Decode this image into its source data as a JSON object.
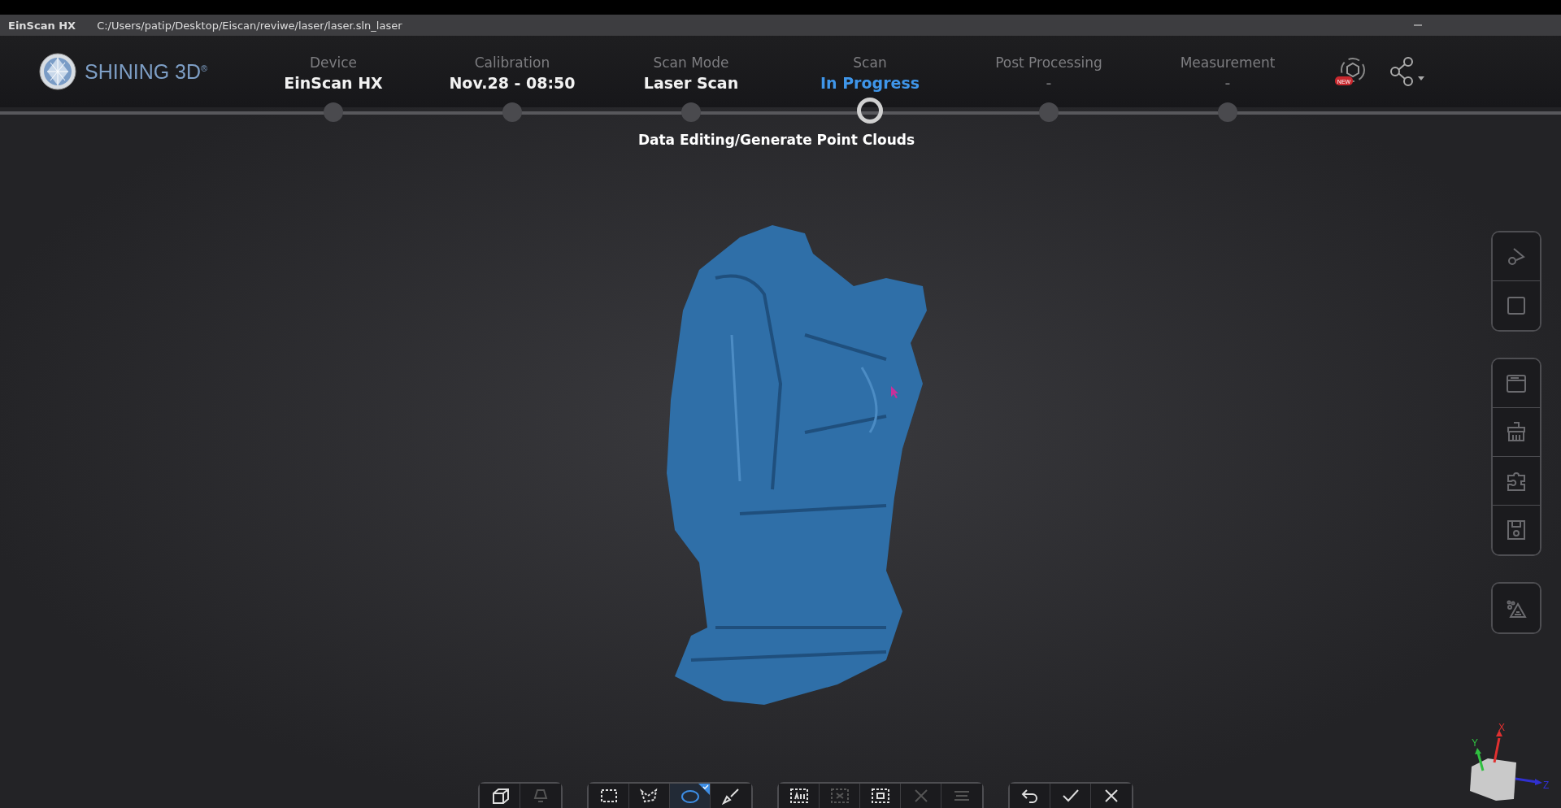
{
  "window": {
    "app_name": "EinScan HX",
    "path": "C:/Users/patip/Desktop/Eiscan/reviwe/laser/laser.sln_laser"
  },
  "brand": {
    "name": "SHINING 3D",
    "mark": "®"
  },
  "steps": [
    {
      "label": "Device",
      "value": "EinScan HX",
      "completed": true,
      "current": false
    },
    {
      "label": "Calibration",
      "value": "Nov.28 - 08:50",
      "completed": true,
      "current": false
    },
    {
      "label": "Scan Mode",
      "value": "Laser Scan",
      "completed": true,
      "current": false
    },
    {
      "label": "Scan",
      "value": "In Progress",
      "completed": false,
      "current": true
    },
    {
      "label": "Post Processing",
      "value": "-",
      "completed": false,
      "current": false
    },
    {
      "label": "Measurement",
      "value": "-",
      "completed": false,
      "current": false
    }
  ],
  "cloud_badge": "NEW",
  "current_task": "Data Editing/Generate Point Clouds",
  "side_toolbar": [
    [
      {
        "kind": "play-settings"
      },
      {
        "kind": "square"
      }
    ],
    [
      {
        "kind": "panel"
      },
      {
        "kind": "brush"
      },
      {
        "kind": "puzzle"
      },
      {
        "kind": "save"
      }
    ],
    [
      {
        "kind": "points"
      }
    ]
  ],
  "bottom_toolbar": [
    [
      {
        "kind": "cube",
        "selected": false,
        "disabled": false
      },
      {
        "kind": "lamp",
        "selected": false,
        "disabled": true
      }
    ],
    [
      {
        "kind": "rect",
        "selected": false,
        "disabled": false
      },
      {
        "kind": "polygon",
        "selected": false,
        "disabled": false
      },
      {
        "kind": "lasso",
        "selected": true,
        "disabled": false
      },
      {
        "kind": "brush",
        "selected": false,
        "disabled": false
      }
    ],
    [
      {
        "kind": "all",
        "selected": false,
        "disabled": false
      },
      {
        "kind": "invert",
        "selected": false,
        "disabled": true
      },
      {
        "kind": "connected",
        "selected": false,
        "disabled": false
      },
      {
        "kind": "delete",
        "selected": false,
        "disabled": true
      },
      {
        "kind": "stack",
        "selected": false,
        "disabled": true
      }
    ],
    [
      {
        "kind": "undo",
        "selected": false,
        "disabled": false
      },
      {
        "kind": "apply",
        "selected": false,
        "disabled": false
      },
      {
        "kind": "cancel",
        "selected": false,
        "disabled": false
      }
    ]
  ],
  "axes": {
    "x": "X",
    "y": "Y",
    "z": "Z"
  }
}
